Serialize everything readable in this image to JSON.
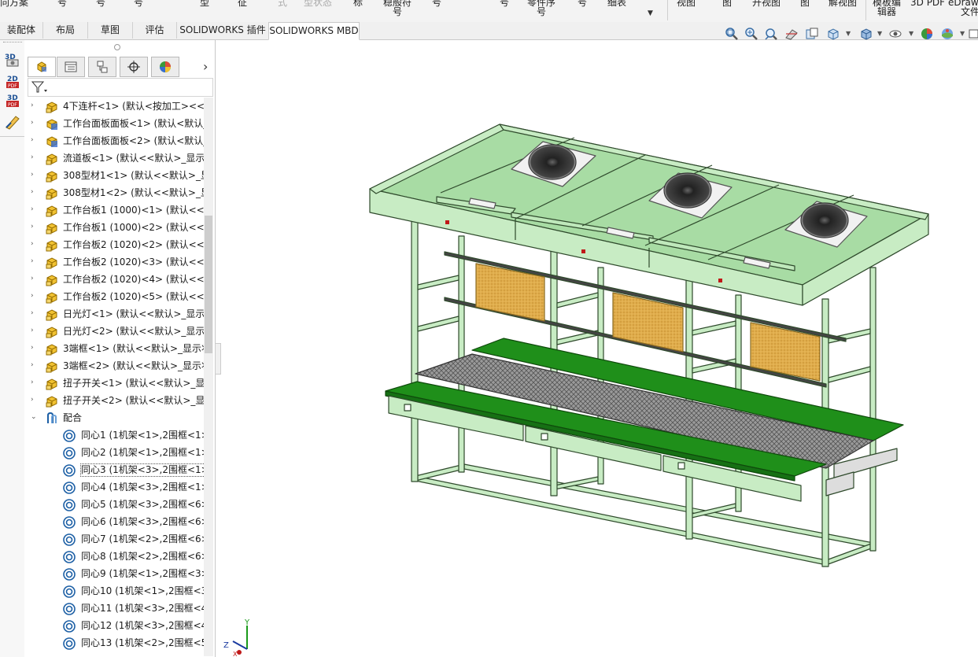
{
  "ribbon": {
    "fragments": [
      "向方案",
      "号",
      "号",
      "号",
      "型",
      "征",
      "式",
      "型状态",
      "标",
      "稳般符号",
      "号",
      "号",
      "零件序号",
      "号",
      "细表",
      "视图",
      "图",
      "开视图",
      "图",
      "解视图",
      "模板编辑器",
      "3D PDF",
      "eDrawings 文件"
    ]
  },
  "tabs": [
    "装配体",
    "布局",
    "草图",
    "评估",
    "SOLIDWORKS 插件",
    "SOLIDWORKS MBD"
  ],
  "active_tab": "SOLIDWORKS MBD",
  "view_tools": [
    "zoom-to-fit-icon",
    "zoom-to-area-icon",
    "previous-view-icon",
    "section-view-icon",
    "dynamic-annotation-icon",
    "view-orientation-icon",
    "display-style-icon",
    "hide-show-icon",
    "edit-appearance-icon",
    "apply-scene-icon",
    "view-settings-icon"
  ],
  "left_strip": [
    "3d-views-icon",
    "publish-2d-pdf-icon",
    "publish-3d-pdf-icon",
    "mbd-dimension-icon"
  ],
  "feature_manager": {
    "tabs": [
      "featuremanager-tree-icon",
      "propertymanager-icon",
      "configurationmanager-icon",
      "dimxpertmanager-icon",
      "displaymanager-icon"
    ],
    "more": "›",
    "filter": "filter-icon"
  },
  "tree": [
    {
      "label": "4下连杆<1> (默认<按加工><<默",
      "icon": "component",
      "expand": "›"
    },
    {
      "label": "工作台面板面板<1> (默认<默认_",
      "icon": "component-blue",
      "expand": "›"
    },
    {
      "label": "工作台面板面板<2> (默认<默认_",
      "icon": "component-blue",
      "expand": "›"
    },
    {
      "label": "流道板<1> (默认<<默认>_显示状",
      "icon": "component",
      "expand": "›"
    },
    {
      "label": "308型材1<1> (默认<<默认>_显",
      "icon": "component",
      "expand": "›"
    },
    {
      "label": "308型材1<2> (默认<<默认>_显",
      "icon": "component",
      "expand": "›"
    },
    {
      "label": "工作台板1 (1000)<1> (默认<<默",
      "icon": "component",
      "expand": "›"
    },
    {
      "label": "工作台板1 (1000)<2> (默认<<默",
      "icon": "component",
      "expand": "›"
    },
    {
      "label": "工作台板2 (1020)<2> (默认<<默",
      "icon": "component",
      "expand": "›"
    },
    {
      "label": "工作台板2 (1020)<3> (默认<<默",
      "icon": "component",
      "expand": "›"
    },
    {
      "label": "工作台板2 (1020)<4> (默认<<默",
      "icon": "component",
      "expand": "›"
    },
    {
      "label": "工作台板2 (1020)<5> (默认<<默",
      "icon": "component",
      "expand": "›"
    },
    {
      "label": "日光灯<1> (默认<<默认>_显示状",
      "icon": "component",
      "expand": "›"
    },
    {
      "label": "日光灯<2> (默认<<默认>_显示状",
      "icon": "component",
      "expand": "›"
    },
    {
      "label": "3端框<1> (默认<<默认>_显示状",
      "icon": "component",
      "expand": "›"
    },
    {
      "label": "3端框<2> (默认<<默认>_显示状",
      "icon": "component",
      "expand": "›"
    },
    {
      "label": "扭子开关<1> (默认<<默认>_显示",
      "icon": "component",
      "expand": "›"
    },
    {
      "label": "扭子开关<2> (默认<<默认>_显示",
      "icon": "component",
      "expand": "›"
    },
    {
      "label": "配合",
      "icon": "mates",
      "expand": "⌄"
    },
    {
      "label": "同心1 (1机架<1>,2围框<1>",
      "icon": "concentric"
    },
    {
      "label": "同心2 (1机架<1>,2围框<1>",
      "icon": "concentric"
    },
    {
      "label": "同心3 (1机架<3>,2围框<1>",
      "icon": "concentric",
      "selected": true
    },
    {
      "label": "同心4 (1机架<3>,2围框<1>",
      "icon": "concentric"
    },
    {
      "label": "同心5 (1机架<3>,2围框<6>",
      "icon": "concentric"
    },
    {
      "label": "同心6 (1机架<3>,2围框<6>",
      "icon": "concentric"
    },
    {
      "label": "同心7 (1机架<2>,2围框<6>",
      "icon": "concentric"
    },
    {
      "label": "同心8 (1机架<2>,2围框<6>",
      "icon": "concentric"
    },
    {
      "label": "同心9 (1机架<1>,2围框<3>",
      "icon": "concentric"
    },
    {
      "label": "同心10 (1机架<1>,2围框<3",
      "icon": "concentric"
    },
    {
      "label": "同心11 (1机架<3>,2围框<4",
      "icon": "concentric"
    },
    {
      "label": "同心12 (1机架<3>,2围框<4",
      "icon": "concentric"
    },
    {
      "label": "同心13 (1机架<2>,2围框<5",
      "icon": "concentric"
    }
  ],
  "triad": {
    "x": "X",
    "y": "Y",
    "z": "Z"
  },
  "colors": {
    "frame": "#c8ecc4",
    "frame_edge": "#2f4a2c",
    "worktop": "#1f8f1a",
    "canopy_panel": "#a8dca4",
    "cork": "#e3b455",
    "mesh": "#8a8a8a",
    "accent_red": "#c01818"
  }
}
